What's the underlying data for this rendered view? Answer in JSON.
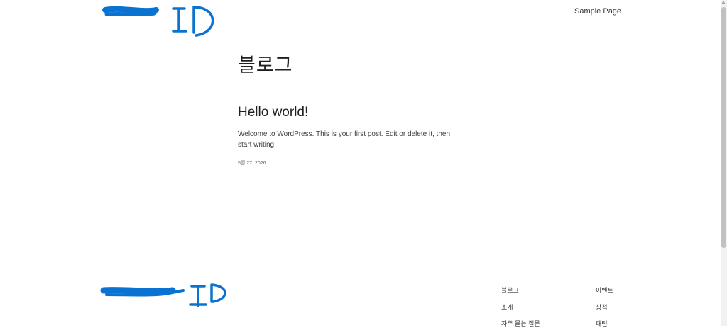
{
  "header": {
    "logo_text": "ID",
    "nav": {
      "sample_page": "Sample Page"
    }
  },
  "main": {
    "page_title": "블로그",
    "post": {
      "title": "Hello world!",
      "excerpt": "Welcome to WordPress. This is your first post. Edit or delete it, then start writing!",
      "date": "5월 27, 2026"
    }
  },
  "footer": {
    "logo_text": "ID",
    "nav_col1": [
      "블로그",
      "소개",
      "자주 묻는 질문"
    ],
    "nav_col2": [
      "이벤트",
      "상점",
      "패턴"
    ]
  },
  "colors": {
    "scribble": "#0a73d1",
    "text": "#1f1f1f"
  },
  "icons": {
    "scroll_up": "chevron-up-icon"
  }
}
